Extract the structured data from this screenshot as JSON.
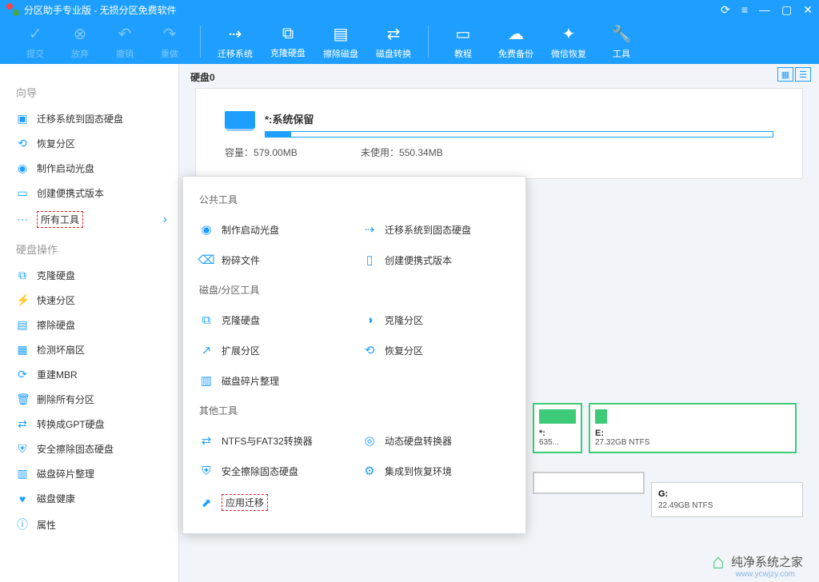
{
  "title": "分区助手专业版 - 无损分区免费软件",
  "toolbar": {
    "commit": "提交",
    "discard": "放弃",
    "undo": "撤销",
    "redo": "重做",
    "migrate": "迁移系统",
    "clonehdd": "克隆硬盘",
    "wipedisk": "擦除磁盘",
    "diskconv": "磁盘转换",
    "tutorial": "教程",
    "freebackup": "免费备份",
    "wechatrecov": "微信恢复",
    "tools": "工具"
  },
  "sidebar": {
    "wizard_h": "向导",
    "wizard": [
      {
        "label": "迁移系统到固态硬盘"
      },
      {
        "label": "恢复分区"
      },
      {
        "label": "制作启动光盘"
      },
      {
        "label": "创建便携式版本"
      },
      {
        "label": "所有工具"
      }
    ],
    "diskops_h": "硬盘操作",
    "diskops": [
      {
        "label": "克隆硬盘"
      },
      {
        "label": "快速分区"
      },
      {
        "label": "擦除硬盘"
      },
      {
        "label": "检测坏扇区"
      },
      {
        "label": "重建MBR"
      },
      {
        "label": "删除所有分区"
      },
      {
        "label": "转换成GPT硬盘"
      },
      {
        "label": "安全擦除固态硬盘"
      },
      {
        "label": "磁盘碎片整理"
      },
      {
        "label": "磁盘健康"
      },
      {
        "label": "属性"
      }
    ]
  },
  "content": {
    "disk_label": "硬盘0",
    "part_title": "*:系统保留",
    "capacity_l": "容量：",
    "capacity_v": "579.00MB",
    "unused_l": "未使用：",
    "unused_v": "550.34MB"
  },
  "popup": {
    "sect1": "公共工具",
    "s1": [
      "制作启动光盘",
      "迁移系统到固态硬盘",
      "粉碎文件",
      "创建便携式版本"
    ],
    "sect2": "磁盘/分区工具",
    "s2": [
      "克隆硬盘",
      "克隆分区",
      "扩展分区",
      "恢复分区",
      "磁盘碎片整理"
    ],
    "sect3": "其他工具",
    "s3": [
      "NTFS与FAT32转换器",
      "动态硬盘转换器",
      "安全擦除固态硬盘",
      "集成到恢复环境",
      "应用迁移"
    ]
  },
  "disks": {
    "d1_l": "*:",
    "d1_s": "635...",
    "d2_l": "E:",
    "d2_s": "27.32GB NTFS",
    "d3_l": "G:",
    "d3_s": "22.49GB NTFS"
  },
  "footer": {
    "brand": "纯净系统之家",
    "url": "www.ycwjzy.com"
  },
  "chart_data": {
    "type": "bar",
    "title": "*:系统保留",
    "categories": [
      "Used",
      "Unused"
    ],
    "values": [
      28.66,
      550.34
    ],
    "ylabel": "MB",
    "ylim": [
      0,
      579
    ],
    "capacity_mb": 579.0,
    "unused_mb": 550.34
  }
}
